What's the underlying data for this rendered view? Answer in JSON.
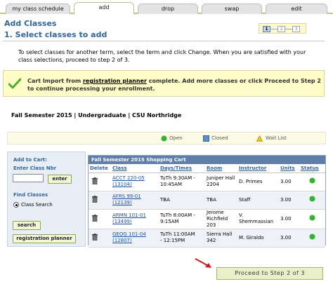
{
  "tabs": [
    {
      "label": "my class schedule"
    },
    {
      "label": "add"
    },
    {
      "label": "drop"
    },
    {
      "label": "swap"
    },
    {
      "label": "edit"
    }
  ],
  "page_title": "Add Classes",
  "steps": {
    "current": "1",
    "two": "2",
    "three": "3"
  },
  "step_heading": "1.  Select classes to add",
  "instructions": "To select classes for another term, select the term and click Change.  When you are satisfied with your class selections, proceed to step 2 of 3.",
  "message": {
    "before": "Cart Import from ",
    "link": "registration planner",
    "after": " complete. Add more classes or click Proceed to Step 2 to continue processing your enrollment."
  },
  "term": "Fall Semester 2015 | Undergraduate | CSU Northridge",
  "legend": {
    "open": "Open",
    "closed": "Closed",
    "wait_list": "Wait List"
  },
  "add_to_cart": {
    "title": "Add to Cart:",
    "enter_class_nbr": "Enter Class Nbr",
    "class_nbr_value": "",
    "enter_button": "enter",
    "find_classes": "Find Classes",
    "class_search": "Class Search",
    "search_button": "search",
    "planner_button": "registration planner"
  },
  "cart": {
    "title": "Fall Semester 2015 Shopping Cart",
    "headers": [
      "Delete",
      "Class",
      "Days/Times",
      "Room",
      "Instructor",
      "Units",
      "Status"
    ],
    "rows": [
      {
        "class": "ACCT 220-05",
        "nbr": "(13104)",
        "days": "TuTh 9:30AM -",
        "times": "10:45AM",
        "room": "Juniper Hall 2204",
        "instructor": "D. Primes",
        "units": "3.00",
        "status": "open"
      },
      {
        "class": "AFRS 99-01",
        "nbr": "(12139)",
        "days": "TBA",
        "times": "",
        "room": "TBA",
        "instructor": "Staff",
        "units": "3.00",
        "status": "open"
      },
      {
        "class": "ARMN 101-01",
        "nbr": "(13499)",
        "days": "TuTh 8:00AM -",
        "times": "9:15AM",
        "room": "Jerome Richfield 203",
        "instructor": "V. Shemmassian",
        "units": "3.00",
        "status": "open"
      },
      {
        "class": "GEOG 101-04",
        "nbr": "(12807)",
        "days": "TuTh 11:00AM",
        "times": "- 12:15PM",
        "room": "Sierra Hall 342",
        "instructor": "M. Giraldo",
        "units": "3.00",
        "status": "open"
      }
    ]
  },
  "proceed_button": "Proceed to Step 2 of 3",
  "colors": {
    "accent": "#336699",
    "open": "#2fb52f",
    "cart_header": "#5f7fa9"
  }
}
